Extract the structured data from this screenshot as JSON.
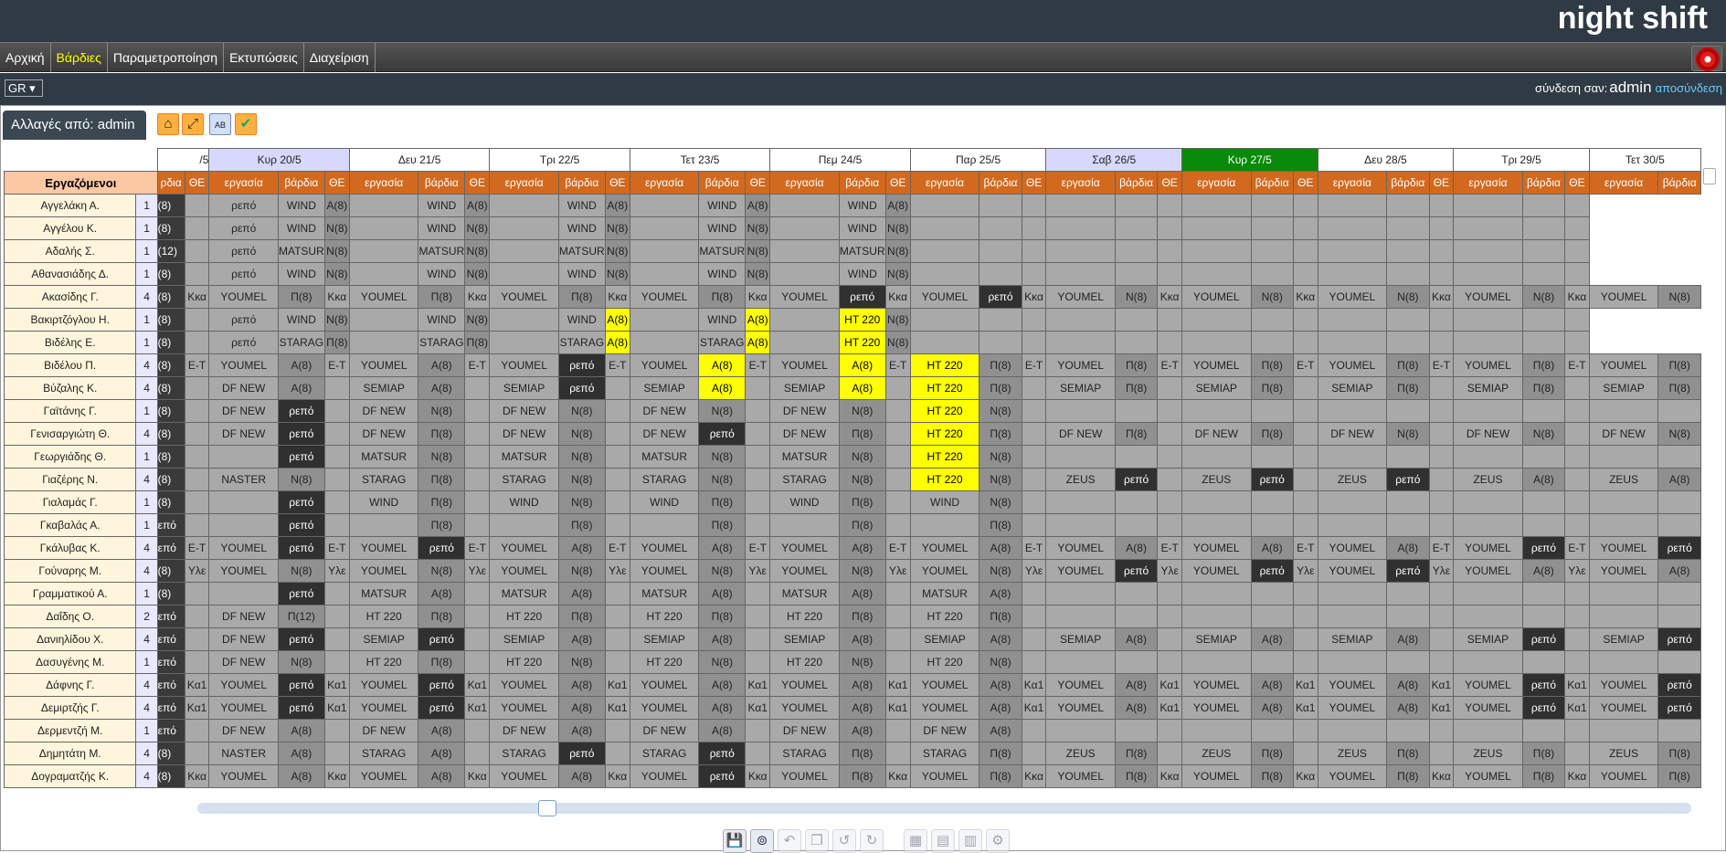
{
  "app": {
    "title": "night shift"
  },
  "menu": [
    "Αρχική",
    "Βάρδιες",
    "Παραμετροποίηση",
    "Εκτυπώσεις",
    "Διαχείριση"
  ],
  "menu_active": 1,
  "lang": {
    "value": "GR ▾"
  },
  "login": {
    "label": "σύνδεση σαν:",
    "user": "admin",
    "logout": "αποσύνδεση"
  },
  "changes_tab": {
    "label": "Αλλαγές από: admin"
  },
  "toolbar_icons": [
    "home-icon",
    "expand-icon",
    "ab-icon",
    "globe-check-icon"
  ],
  "table": {
    "employees_header": "Εργαζόμενοι",
    "days": [
      "/5",
      "Κυρ 20/5",
      "Δευ 21/5",
      "Τρι 22/5",
      "Τετ 23/5",
      "Πεμ 24/5",
      "Παρ 25/5",
      "Σαβ 26/5",
      "Κυρ 27/5",
      "Δευ 28/5",
      "Τρι 29/5",
      "Τετ 30/5"
    ],
    "highlighted_days": [
      1,
      7
    ],
    "today_day": 8,
    "sub_headers": {
      "group": "ΘΕ",
      "work": "εργασία",
      "shift": "βάρδια",
      "partial_shift": "ρδια"
    },
    "rows": [
      {
        "name": "Αγγελάκη Α.",
        "n": "1",
        "c": [
          "V|(8)",
          "|",
          "|ρεπό",
          "|WIND",
          "A|A(8)",
          "|",
          "|WIND",
          "D|A(8)",
          "|",
          "|WIND",
          "D|A(8)",
          "|",
          "|WIND",
          "D|A(8)",
          "|",
          "|WIND",
          "D|A(8)",
          "|",
          "|",
          "|",
          "|",
          "|",
          "|",
          "|",
          "|",
          "|",
          "|",
          "|",
          "|",
          "|",
          "|",
          "|"
        ]
      },
      {
        "name": "Αγγέλου Κ.",
        "n": "1",
        "c": [
          "V|(8)",
          "|",
          "|ρεπό",
          "|WIND",
          "A|N(8)",
          "|",
          "|WIND",
          "D|N(8)",
          "|",
          "|WIND",
          "D|N(8)",
          "|",
          "|WIND",
          "D|N(8)",
          "|",
          "|WIND",
          "D|N(8)",
          "|",
          "|",
          "|",
          "|",
          "|",
          "|",
          "|",
          "|",
          "|",
          "|",
          "|",
          "|",
          "|",
          "|",
          "|"
        ]
      },
      {
        "name": "Αδαλής Σ.",
        "n": "1",
        "c": [
          "V|(12)",
          "|",
          "|ρεπό",
          "|MATSUR",
          "A|N(8)",
          "|",
          "|MATSUR",
          "D|N(8)",
          "|",
          "|MATSUR",
          "D|N(8)",
          "|",
          "|MATSUR",
          "D|N(8)",
          "|",
          "|MATSUR",
          "D|N(8)",
          "|",
          "|",
          "|",
          "|",
          "|",
          "|",
          "|",
          "|",
          "|",
          "|",
          "|",
          "|",
          "|",
          "|",
          "|"
        ]
      },
      {
        "name": "Αθανασιάδης Δ.",
        "n": "1",
        "c": [
          "V|(8)",
          "|",
          "|ρεπό",
          "|WIND",
          "A|N(8)",
          "|",
          "|WIND",
          "D|N(8)",
          "|",
          "|WIND",
          "D|N(8)",
          "|",
          "|WIND",
          "D|N(8)",
          "|",
          "|WIND",
          "D|N(8)",
          "|",
          "|",
          "|",
          "|",
          "|",
          "|",
          "|",
          "|",
          "|",
          "|",
          "|",
          "|",
          "|",
          "|",
          "|"
        ]
      },
      {
        "name": "Ακασίδης Γ.",
        "n": "4",
        "c": [
          "V|(8)",
          "|Κκα",
          "|YOUMEL",
          "A|Π(8)",
          "|Κκα",
          "|YOUMEL",
          "A|Π(8)",
          "|Κκα",
          "|YOUMEL",
          "D|Π(8)",
          "|Κκα",
          "|YOUMEL",
          "D|Π(8)",
          "|Κκα",
          "|YOUMEL",
          "R|ρεπό",
          "|Κκα",
          "|YOUMEL",
          "R|ρεπό",
          "|Κκα",
          "|YOUMEL",
          "D|N(8)",
          "|Κκα",
          "|YOUMEL",
          "D|N(8)",
          "|Κκα",
          "|YOUMEL",
          "D|N(8)",
          "|Κκα",
          "|YOUMEL",
          "D|N(8)",
          "|Κκα",
          "|YOUMEL",
          "D|N(8)"
        ]
      },
      {
        "name": "Βακιρτζόγλου Η.",
        "n": "1",
        "c": [
          "V|(8)",
          "|",
          "|ρεπό",
          "|WIND",
          "A|N(8)",
          "|",
          "|WIND",
          "D|N(8)",
          "|",
          "|WIND",
          "Y|A(8)",
          "|",
          "|WIND",
          "Y|A(8)",
          "|",
          "Y|HT 220",
          "D|N(8)",
          "|",
          "|",
          "|",
          "|",
          "|",
          "|",
          "|",
          "|",
          "|",
          "|",
          "|",
          "|",
          "|",
          "|",
          "|"
        ]
      },
      {
        "name": "Βιδέλης Ε.",
        "n": "1",
        "c": [
          "V|(8)",
          "|",
          "|ρεπό",
          "|STARAG",
          "A|Π(8)",
          "|",
          "|STARAG",
          "D|Π(8)",
          "|",
          "|STARAG",
          "Y|A(8)",
          "|",
          "|STARAG",
          "Y|A(8)",
          "|",
          "Y|HT 220",
          "D|N(8)",
          "|",
          "|",
          "|",
          "|",
          "|",
          "|",
          "|",
          "|",
          "|",
          "|",
          "|",
          "|",
          "|",
          "|",
          "|"
        ]
      },
      {
        "name": "Βιδέλου Π.",
        "n": "4",
        "c": [
          "V|(8)",
          "|E-T",
          "|YOUMEL",
          "A|A(8)",
          "|E-T",
          "|YOUMEL",
          "A|A(8)",
          "|E-T",
          "|YOUMEL",
          "R|ρεπό",
          "|E-T",
          "|YOUMEL",
          "Y|A(8)",
          "|E-T",
          "|YOUMEL",
          "Y|A(8)",
          "|E-T",
          "Y|HT 220",
          "D|Π(8)",
          "|E-T",
          "|YOUMEL",
          "D|Π(8)",
          "|E-T",
          "|YOUMEL",
          "D|Π(8)",
          "|E-T",
          "|YOUMEL",
          "D|Π(8)",
          "|E-T",
          "|YOUMEL",
          "D|Π(8)",
          "|E-T",
          "|YOUMEL",
          "D|Π(8)"
        ]
      },
      {
        "name": "Βύζαλης Κ.",
        "n": "4",
        "c": [
          "V|(8)",
          "|",
          "|DF NEW",
          "A|A(8)",
          "|",
          "|SEMIAP",
          "A|A(8)",
          "|",
          "|SEMIAP",
          "R|ρεπό",
          "|",
          "|SEMIAP",
          "Y|A(8)",
          "|",
          "|SEMIAP",
          "Y|A(8)",
          "|",
          "Y|HT 220",
          "D|Π(8)",
          "|",
          "|SEMIAP",
          "D|Π(8)",
          "|",
          "|SEMIAP",
          "D|Π(8)",
          "|",
          "|SEMIAP",
          "D|Π(8)",
          "|",
          "|SEMIAP",
          "D|Π(8)",
          "|",
          "|SEMIAP",
          "D|Π(8)"
        ]
      },
      {
        "name": "Γαϊτάνης Γ.",
        "n": "1",
        "c": [
          "V|(8)",
          "|",
          "|DF NEW",
          "R|ρεπό",
          "|",
          "|DF NEW",
          "A|N(8)",
          "|",
          "|DF NEW",
          "D|N(8)",
          "|",
          "|DF NEW",
          "D|N(8)",
          "|",
          "|DF NEW",
          "D|N(8)",
          "|",
          "Y|HT 220",
          "D|N(8)",
          "|",
          "|",
          "|",
          "|",
          "|",
          "|",
          "|",
          "|",
          "|",
          "|",
          "|",
          "|",
          "|",
          "|",
          "|"
        ]
      },
      {
        "name": "Γενισαργιώτη Θ.",
        "n": "4",
        "c": [
          "V|(8)",
          "|",
          "|DF NEW",
          "R|ρεπό",
          "|",
          "|DF NEW",
          "A|Π(8)",
          "|",
          "|DF NEW",
          "D|N(8)",
          "|",
          "|DF NEW",
          "R|ρεπό",
          "|",
          "|DF NEW",
          "D|Π(8)",
          "|",
          "Y|HT 220",
          "D|Π(8)",
          "|",
          "|DF NEW",
          "D|Π(8)",
          "|",
          "|DF NEW",
          "D|Π(8)",
          "|",
          "|DF NEW",
          "D|N(8)",
          "|",
          "|DF NEW",
          "D|N(8)",
          "|",
          "|DF NEW",
          "D|N(8)"
        ]
      },
      {
        "name": "Γεωργιάδης Θ.",
        "n": "1",
        "c": [
          "V|(8)",
          "|",
          "|",
          "R|ρεπό",
          "|",
          "|MATSUR",
          "A|N(8)",
          "|",
          "|MATSUR",
          "D|N(8)",
          "|",
          "|MATSUR",
          "D|N(8)",
          "|",
          "|MATSUR",
          "D|N(8)",
          "|",
          "Y|HT 220",
          "D|N(8)",
          "|",
          "|",
          "|",
          "|",
          "|",
          "|",
          "|",
          "|",
          "|",
          "|",
          "|",
          "|",
          "|",
          "|",
          "|"
        ]
      },
      {
        "name": "Γιαζέρης Ν.",
        "n": "4",
        "c": [
          "V|(8)",
          "|",
          "|NASTER",
          "D|N(8)",
          "|",
          "|STARAG",
          "A|Π(8)",
          "|",
          "|STARAG",
          "D|N(8)",
          "|",
          "|STARAG",
          "D|N(8)",
          "|",
          "|STARAG",
          "D|N(8)",
          "|",
          "Y|HT 220",
          "D|N(8)",
          "|",
          "|ZEUS",
          "R|ρεπό",
          "|",
          "|ZEUS",
          "R|ρεπό",
          "|",
          "|ZEUS",
          "R|ρεπό",
          "|",
          "|ZEUS",
          "D|A(8)",
          "|",
          "|ZEUS",
          "D|A(8)"
        ]
      },
      {
        "name": "Γιαλαμάς Γ.",
        "n": "1",
        "c": [
          "V|(8)",
          "|",
          "|",
          "R|ρεπό",
          "|",
          "|WIND",
          "A|Π(8)",
          "|",
          "|WIND",
          "D|N(8)",
          "|",
          "|WIND",
          "D|Π(8)",
          "|",
          "|WIND",
          "D|Π(8)",
          "|",
          "|WIND",
          "D|N(8)",
          "|",
          "|",
          "|",
          "|",
          "|",
          "|",
          "|",
          "|",
          "|",
          "|",
          "|",
          "|",
          "|",
          "|",
          "|"
        ]
      },
      {
        "name": "Γκαβαλάς Α.",
        "n": "1",
        "c": [
          "V|επό",
          "|",
          "|",
          "R|ρεπό",
          "|",
          "|",
          "A|Π(8)",
          "|",
          "|",
          "D|Π(8)",
          "|",
          "|",
          "D|Π(8)",
          "|",
          "|",
          "D|Π(8)",
          "|",
          "|",
          "D|Π(8)",
          "|",
          "|",
          "|",
          "|",
          "|",
          "|",
          "|",
          "|",
          "|",
          "|",
          "|",
          "|",
          "|",
          "|",
          "|"
        ]
      },
      {
        "name": "Γκάλυβας Κ.",
        "n": "4",
        "c": [
          "V|επό",
          "|E-T",
          "|YOUMEL",
          "R|ρεπό",
          "|E-T",
          "|YOUMEL",
          "R|ρεπό",
          "|E-T",
          "|YOUMEL",
          "D|A(8)",
          "|E-T",
          "|YOUMEL",
          "D|A(8)",
          "|E-T",
          "|YOUMEL",
          "D|A(8)",
          "|E-T",
          "|YOUMEL",
          "D|A(8)",
          "|E-T",
          "|YOUMEL",
          "D|A(8)",
          "|E-T",
          "|YOUMEL",
          "D|A(8)",
          "|E-T",
          "|YOUMEL",
          "D|A(8)",
          "|E-T",
          "|YOUMEL",
          "R|ρεπό",
          "|E-T",
          "|YOUMEL",
          "R|ρεπό"
        ]
      },
      {
        "name": "Γούναρης Μ.",
        "n": "4",
        "c": [
          "V|(8)",
          "|Υλε",
          "|YOUMEL",
          "D|N(8)",
          "|Υλε",
          "|YOUMEL",
          "A|N(8)",
          "|Υλε",
          "|YOUMEL",
          "D|N(8)",
          "|Υλε",
          "|YOUMEL",
          "D|N(8)",
          "|Υλε",
          "|YOUMEL",
          "D|N(8)",
          "|Υλε",
          "|YOUMEL",
          "D|N(8)",
          "|Υλε",
          "|YOUMEL",
          "R|ρεπό",
          "|Υλε",
          "|YOUMEL",
          "R|ρεπό",
          "|Υλε",
          "|YOUMEL",
          "R|ρεπό",
          "|Υλε",
          "|YOUMEL",
          "D|A(8)",
          "|Υλε",
          "|YOUMEL",
          "D|A(8)"
        ]
      },
      {
        "name": "Γραμματικού Α.",
        "n": "1",
        "c": [
          "V|(8)",
          "|",
          "|",
          "R|ρεπό",
          "|",
          "|MATSUR",
          "A|A(8)",
          "|",
          "|MATSUR",
          "D|A(8)",
          "|",
          "|MATSUR",
          "D|A(8)",
          "|",
          "|MATSUR",
          "D|A(8)",
          "|",
          "|MATSUR",
          "D|A(8)",
          "|",
          "|",
          "|",
          "|",
          "|",
          "|",
          "|",
          "|",
          "|",
          "|",
          "|",
          "|",
          "|",
          "|",
          "|"
        ]
      },
      {
        "name": "Δαΐδης Ο.",
        "n": "2",
        "c": [
          "V|επό",
          "|",
          "|DF NEW",
          "P|Π(12)",
          "|",
          "|HT 220",
          "A|Π(8)",
          "|",
          "|HT 220",
          "D|Π(8)",
          "|",
          "|HT 220",
          "D|Π(8)",
          "|",
          "|HT 220",
          "D|Π(8)",
          "|",
          "|HT 220",
          "D|Π(8)",
          "|",
          "|",
          "|",
          "|",
          "|",
          "|",
          "|",
          "|",
          "|",
          "|",
          "|",
          "|",
          "|",
          "|",
          "|"
        ]
      },
      {
        "name": "Δανιηλίδου Χ.",
        "n": "4",
        "c": [
          "V|επό",
          "|",
          "|DF NEW",
          "R|ρεπό",
          "|",
          "|SEMIAP",
          "R|ρεπό",
          "|",
          "|SEMIAP",
          "D|A(8)",
          "|",
          "|SEMIAP",
          "D|A(8)",
          "|",
          "|SEMIAP",
          "D|A(8)",
          "|",
          "|SEMIAP",
          "D|A(8)",
          "|",
          "|SEMIAP",
          "D|A(8)",
          "|",
          "|SEMIAP",
          "D|A(8)",
          "|",
          "|SEMIAP",
          "D|A(8)",
          "|",
          "|SEMIAP",
          "R|ρεπό",
          "|",
          "|SEMIAP",
          "R|ρεπό"
        ]
      },
      {
        "name": "Δασυγένης Μ.",
        "n": "1",
        "c": [
          "V|επό",
          "|",
          "|DF NEW",
          "D|N(8)",
          "|",
          "|HT 220",
          "A|Π(8)",
          "|",
          "|HT 220",
          "D|N(8)",
          "|",
          "|HT 220",
          "D|N(8)",
          "|",
          "|HT 220",
          "D|N(8)",
          "|",
          "|HT 220",
          "D|N(8)",
          "|",
          "|",
          "|",
          "|",
          "|",
          "|",
          "|",
          "|",
          "|",
          "|",
          "|",
          "|",
          "|",
          "|",
          "|"
        ]
      },
      {
        "name": "Δάφνης Γ.",
        "n": "4",
        "c": [
          "V|επό",
          "|Κα1",
          "|YOUMEL",
          "R|ρεπό",
          "|Κα1",
          "|YOUMEL",
          "R|ρεπό",
          "|Κα1",
          "|YOUMEL",
          "D|A(8)",
          "|Κα1",
          "|YOUMEL",
          "D|A(8)",
          "|Κα1",
          "|YOUMEL",
          "D|A(8)",
          "|Κα1",
          "|YOUMEL",
          "D|A(8)",
          "|Κα1",
          "|YOUMEL",
          "D|A(8)",
          "|Κα1",
          "|YOUMEL",
          "D|A(8)",
          "|Κα1",
          "|YOUMEL",
          "D|A(8)",
          "|Κα1",
          "|YOUMEL",
          "R|ρεπό",
          "|Κα1",
          "|YOUMEL",
          "R|ρεπό"
        ]
      },
      {
        "name": "Δεμιρτζής Γ.",
        "n": "4",
        "c": [
          "V|επό",
          "|Κα1",
          "|YOUMEL",
          "R|ρεπό",
          "|Κα1",
          "|YOUMEL",
          "R|ρεπό",
          "|Κα1",
          "|YOUMEL",
          "D|A(8)",
          "|Κα1",
          "|YOUMEL",
          "D|A(8)",
          "|Κα1",
          "|YOUMEL",
          "D|A(8)",
          "|Κα1",
          "|YOUMEL",
          "D|A(8)",
          "|Κα1",
          "|YOUMEL",
          "D|A(8)",
          "|Κα1",
          "|YOUMEL",
          "D|A(8)",
          "|Κα1",
          "|YOUMEL",
          "D|A(8)",
          "|Κα1",
          "|YOUMEL",
          "R|ρεπό",
          "|Κα1",
          "|YOUMEL",
          "R|ρεπό"
        ]
      },
      {
        "name": "Δερμεντζή Μ.",
        "n": "1",
        "c": [
          "V|επό",
          "|",
          "|DF NEW",
          "D|A(8)",
          "|",
          "|DF NEW",
          "A|A(8)",
          "|",
          "|DF NEW",
          "D|A(8)",
          "|",
          "|DF NEW",
          "D|A(8)",
          "|",
          "|DF NEW",
          "D|A(8)",
          "|",
          "|DF NEW",
          "D|A(8)",
          "|",
          "|",
          "|",
          "|",
          "|",
          "|",
          "|",
          "|",
          "|",
          "|",
          "|",
          "|",
          "|",
          "|",
          "|"
        ]
      },
      {
        "name": "Δημητάτη Μ.",
        "n": "4",
        "c": [
          "V|(8)",
          "|",
          "|NASTER",
          "D|A(8)",
          "|",
          "|STARAG",
          "A|A(8)",
          "|",
          "|STARAG",
          "R|ρεπό",
          "|",
          "|STARAG",
          "R|ρεπό",
          "|",
          "|STARAG",
          "D|Π(8)",
          "|",
          "|STARAG",
          "D|Π(8)",
          "|",
          "|ZEUS",
          "D|Π(8)",
          "|",
          "|ZEUS",
          "D|Π(8)",
          "|",
          "|ZEUS",
          "D|Π(8)",
          "|",
          "|ZEUS",
          "D|Π(8)",
          "|",
          "|ZEUS",
          "D|Π(8)"
        ]
      },
      {
        "name": "Δογραματζής Κ.",
        "n": "4",
        "c": [
          "V|(8)",
          "|Κκα",
          "|YOUMEL",
          "D|A(8)",
          "|Κκα",
          "|YOUMEL",
          "A|A(8)",
          "|Κκα",
          "|YOUMEL",
          "D|A(8)",
          "|Κκα",
          "|YOUMEL",
          "R|ρεπό",
          "|Κκα",
          "|YOUMEL",
          "D|Π(8)",
          "|Κκα",
          "|YOUMEL",
          "D|Π(8)",
          "|Κκα",
          "|YOUMEL",
          "D|Π(8)",
          "|Κκα",
          "|YOUMEL",
          "D|Π(8)",
          "|Κκα",
          "|YOUMEL",
          "D|Π(8)",
          "|Κκα",
          "|YOUMEL",
          "D|Π(8)",
          "|Κκα",
          "|YOUMEL",
          "D|Π(8)"
        ]
      }
    ]
  },
  "scroll": {
    "horizontal_position": 0.12
  },
  "bottom_toolbar": [
    "save-icon",
    "binoculars-icon",
    "undo-list-icon",
    "copy-icon",
    "undo-icon",
    "redo-icon",
    "grid-edit-icon",
    "calendar-icon",
    "chart-icon",
    "settings-link-icon"
  ],
  "bottom_toolbar_enabled": [
    true,
    true,
    false,
    false,
    false,
    false,
    false,
    false,
    false,
    false
  ]
}
